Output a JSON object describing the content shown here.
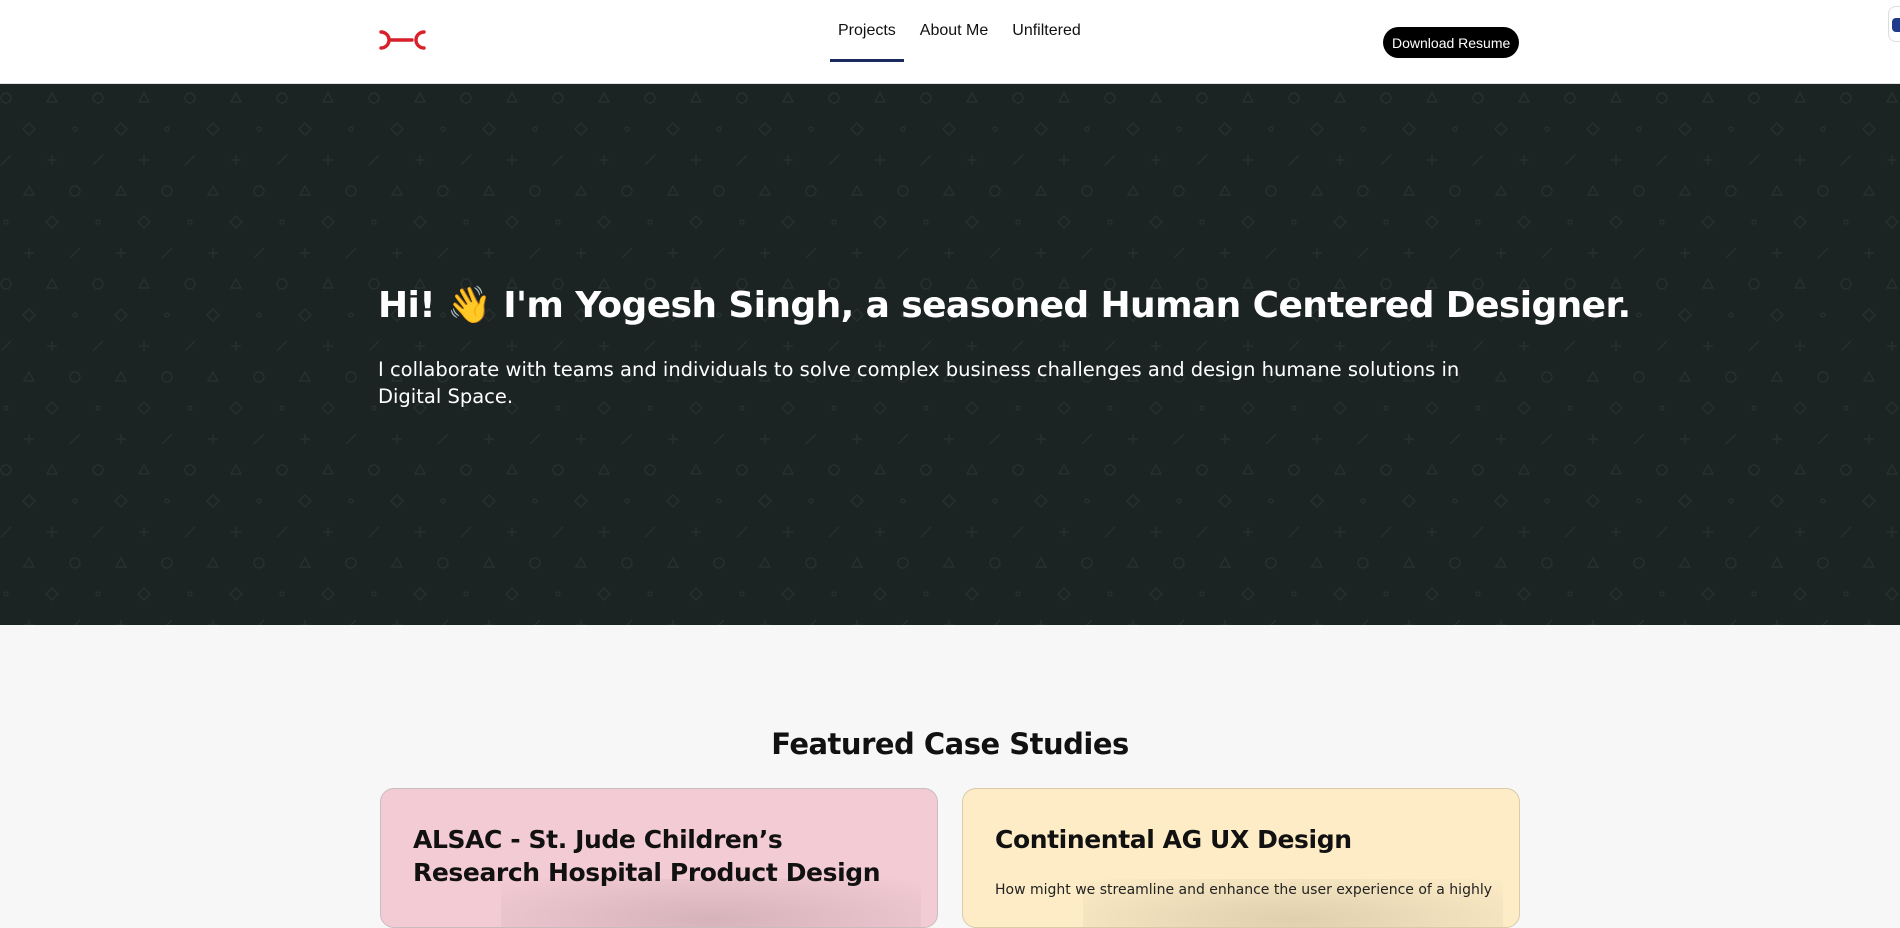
{
  "header": {
    "logo_icon": "monogram-logo-icon",
    "nav": [
      {
        "label": "Projects",
        "active": true
      },
      {
        "label": "About Me",
        "active": false
      },
      {
        "label": "Unfiltered",
        "active": false
      }
    ],
    "download_label": "Download Resume"
  },
  "hero": {
    "greeting": "Hi!",
    "wave_emoji": "👋",
    "headline": "I'm Yogesh Singh, a seasoned Human Centered Designer.",
    "subtitle": "I collaborate with teams and individuals to solve complex business challenges and design humane solutions in Digital Space."
  },
  "featured": {
    "title": "Featured Case Studies",
    "cards": [
      {
        "title": "ALSAC - St. Jude Children’s Research Hospital Product Design",
        "description": ""
      },
      {
        "title": "Continental AG UX Design",
        "description": "How might we streamline and enhance the user experience of a highly"
      }
    ]
  },
  "colors": {
    "accent_logo": "#d81f2a",
    "hero_bg": "#1b2423",
    "nav_underline": "#1b2a5e",
    "card_pink": "#f3cbd5",
    "card_yellow": "#fdecc6"
  }
}
